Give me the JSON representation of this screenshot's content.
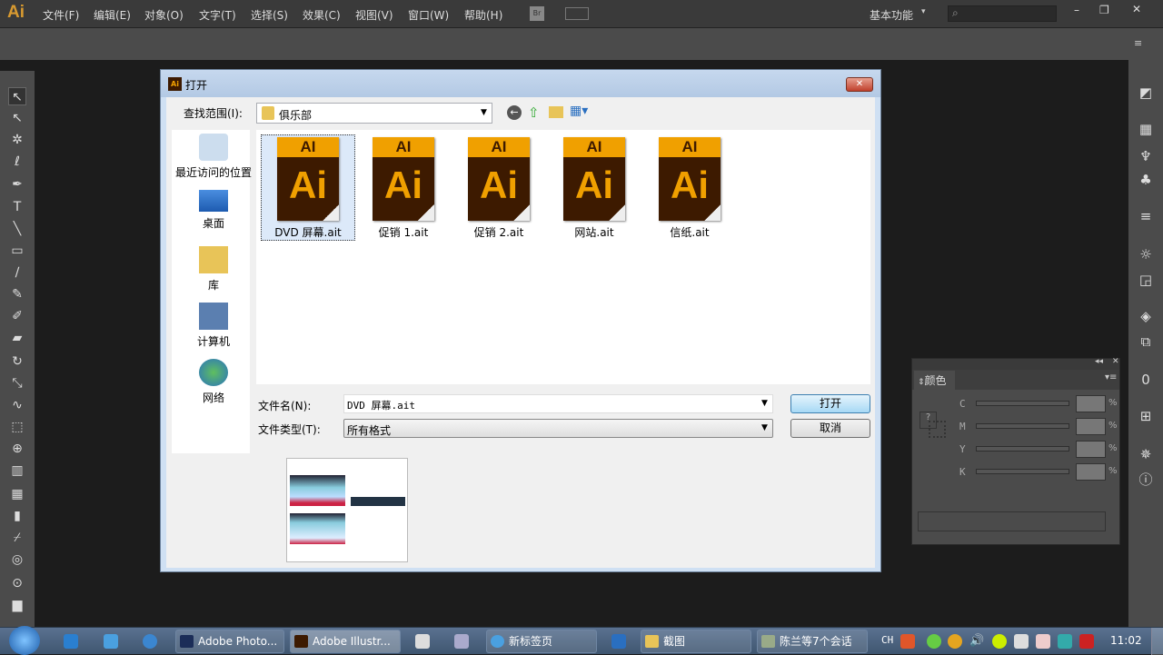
{
  "app": {
    "logo": "Ai",
    "menus": [
      "文件(F)",
      "编辑(E)",
      "对象(O)",
      "文字(T)",
      "选择(S)",
      "效果(C)",
      "视图(V)",
      "窗口(W)",
      "帮助(H)"
    ],
    "bridge": "Br",
    "workspace": "基本功能",
    "search_placeholder": ""
  },
  "dialog": {
    "title": "打开",
    "title_icon": "Ai",
    "look_in_label": "查找范围(I):",
    "look_in_value": "俱乐部",
    "places": [
      "最近访问的位置",
      "桌面",
      "库",
      "计算机",
      "网络"
    ],
    "files": [
      {
        "name": "DVD 屏幕.ait",
        "selected": true
      },
      {
        "name": "促销 1.ait"
      },
      {
        "name": "促销 2.ait"
      },
      {
        "name": "网站.ait"
      },
      {
        "name": "信纸.ait"
      }
    ],
    "icon_top": "AI",
    "icon_big": "Ai",
    "filename_label": "文件名(N):",
    "filename_value": "DVD 屏幕.ait",
    "filetype_label": "文件类型(T):",
    "filetype_value": "所有格式",
    "open_button": "打开",
    "cancel_button": "取消"
  },
  "color_panel": {
    "title": "颜色",
    "channels": [
      "C",
      "M",
      "Y",
      "K"
    ],
    "percent": "%",
    "unknown": "?"
  },
  "taskbar": {
    "tasks": [
      "Adobe Photo...",
      "Adobe Illustr...",
      "新标签页",
      "截图",
      "陈兰等7个会话"
    ],
    "lang": "CH",
    "time": "11:02"
  }
}
